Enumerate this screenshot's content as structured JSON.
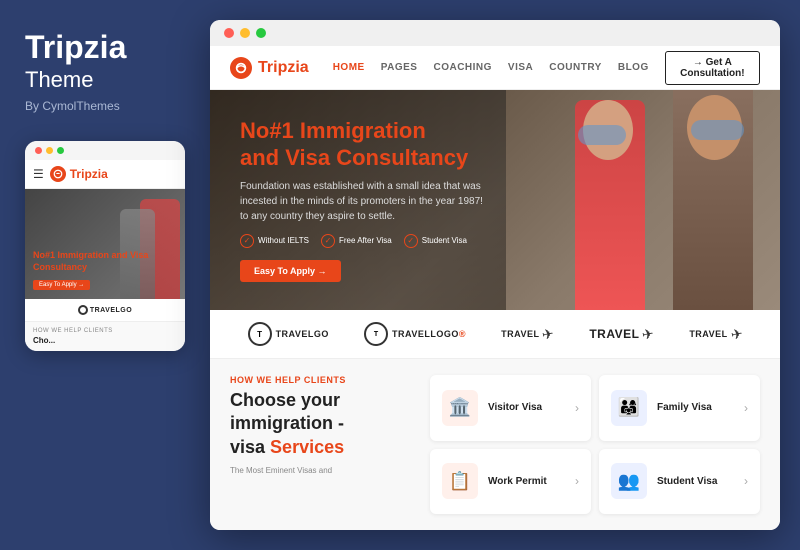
{
  "left_panel": {
    "brand_name": "Tripzia",
    "brand_subtitle": "Theme",
    "brand_by": "By CymolThemes"
  },
  "mobile_mockup": {
    "logo_text_part1": "Trip",
    "logo_text_part2": "zia",
    "hero_title": "No#1 Immigration and Visa Consultancy",
    "hero_btn": "Easy To Apply →",
    "logo_brand": "TRAVELGO",
    "services_label": "HOW WE HELP CLIENTS",
    "services_title": "Cho..."
  },
  "browser": {
    "navbar": {
      "logo_part1": "Trip",
      "logo_part2": "zia",
      "nav_links": [
        {
          "label": "HOME",
          "active": true
        },
        {
          "label": "PAGES",
          "active": false
        },
        {
          "label": "COACHING",
          "active": false
        },
        {
          "label": "VISA",
          "active": false
        },
        {
          "label": "COUNTRY",
          "active": false
        },
        {
          "label": "BLOG",
          "active": false
        }
      ],
      "cta_button": "→ Get A Consultation!"
    },
    "hero": {
      "title_line1": "No#1 Immigration",
      "title_line2": "and Visa Consultancy",
      "description": "Foundation was established with a small idea that was incested in the minds of its promoters in the year 1987! to any country they aspire to settle.",
      "badges": [
        {
          "text": "Without IELTS"
        },
        {
          "text": "Free After Visa"
        },
        {
          "text": "Student Visa"
        }
      ],
      "apply_button": "Easy To Apply →"
    },
    "logos": [
      {
        "name": "TRAVELGO",
        "type": "circle"
      },
      {
        "name": "Travellogo",
        "type": "circle"
      },
      {
        "name": "travel",
        "type": "plane"
      },
      {
        "name": "Travel",
        "type": "plain"
      },
      {
        "name": "travel",
        "type": "plane2"
      }
    ],
    "services": {
      "label": "HOW WE HELP CLIENTS",
      "title_part1": "Choose your\nimmigration -\nvisa ",
      "title_orange": "Services",
      "description": "The Most Eminent Visas and",
      "cards": [
        {
          "name": "Visitor Visa",
          "icon": "🏛️",
          "bg": "orange-bg"
        },
        {
          "name": "Family Visa",
          "icon": "👨‍👩‍👧",
          "bg": "blue-bg"
        },
        {
          "name": "Work Permit",
          "icon": "📋",
          "bg": "orange-bg"
        },
        {
          "name": "Student Visa",
          "icon": "👥",
          "bg": "blue-bg"
        }
      ]
    }
  }
}
